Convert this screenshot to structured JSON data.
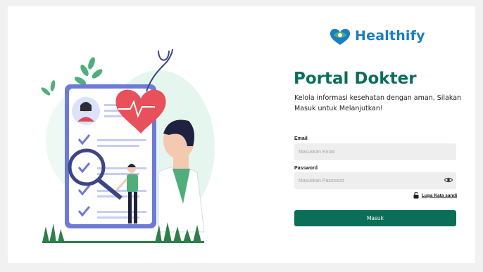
{
  "brand": {
    "name": "Healthify",
    "accent": "#1b7ec0",
    "primary": "#0b6e57"
  },
  "header": {
    "title": "Portal Dokter",
    "subtitle": "Kelola informasi kesehatan dengan aman, Silakan Masuk untuk Melanjutkan!"
  },
  "form": {
    "email_label": "Email",
    "email_placeholder": "Masukkan Email",
    "email_value": "",
    "password_label": "Password",
    "password_placeholder": "Masukkan Password",
    "password_value": "",
    "password_toggle_icon": "eye-icon",
    "forgot_icon": "unlock-icon",
    "forgot_label": "Lupa Kata sandi",
    "submit_label": "Masuk"
  }
}
